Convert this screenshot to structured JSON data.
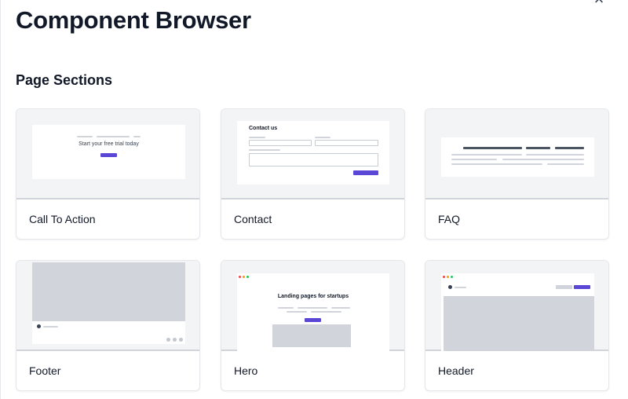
{
  "window": {
    "title": "Component Browser",
    "close_icon": "×"
  },
  "section": {
    "title": "Page Sections"
  },
  "cards": [
    {
      "label": "Call To Action",
      "preview_text": "Start your free trial today"
    },
    {
      "label": "Contact",
      "preview_text": "Contact us"
    },
    {
      "label": "FAQ"
    },
    {
      "label": "Footer"
    },
    {
      "label": "Hero",
      "preview_text": "Landing pages for startups"
    },
    {
      "label": "Header"
    }
  ],
  "colors": {
    "accent": "#5b47d6",
    "placeholder_grey": "#d1d5db",
    "preview_bg": "#f3f4f6",
    "text": "#111827",
    "traffic_red": "#ef4444",
    "traffic_yellow": "#f59e0b",
    "traffic_green": "#22c55e"
  }
}
